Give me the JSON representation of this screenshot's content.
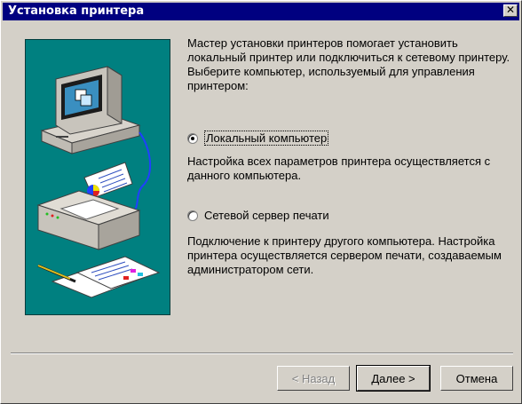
{
  "window": {
    "title": "Установка принтера",
    "close_glyph": "✕"
  },
  "illustration": {
    "icons": [
      "computer-icon",
      "printer-icon",
      "documents-icon"
    ]
  },
  "intro_text": "Мастер установки принтеров помогает установить локальный принтер или подключиться к сетевому принтеру.  Выберите компьютер, используемый для управления принтером:",
  "options": [
    {
      "label": "Локальный компьютер",
      "checked": true,
      "description": "Настройка всех параметров принтера осуществляется с данного компьютера."
    },
    {
      "label": "Сетевой сервер печати",
      "checked": false,
      "description": "Подключение к принтеру другого компьютера. Настройка принтера осуществляется сервером печати, создаваемым администратором сети."
    }
  ],
  "buttons": {
    "back": "< Назад",
    "next": "Далее >",
    "cancel": "Отмена"
  },
  "colors": {
    "title_bar": "#000080",
    "dialog_bg": "#d4d0c8",
    "illustration_bg": "#008080"
  }
}
